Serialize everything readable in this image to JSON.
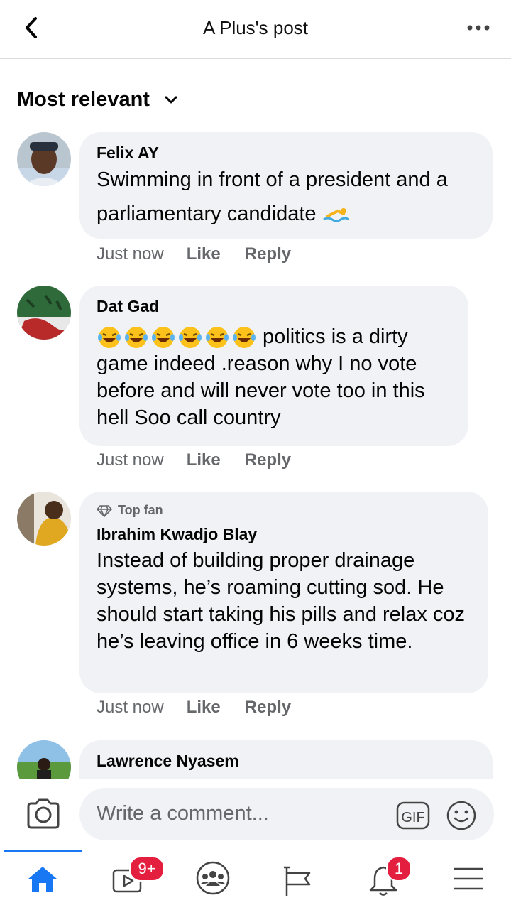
{
  "header": {
    "title": "A Plus's post"
  },
  "sort": {
    "label": "Most relevant"
  },
  "comments": [
    {
      "name": "Felix AY",
      "text": "Swimming in front of a president and a parliamentary candidate",
      "emoji": "swimmer-emoji",
      "time": "Just now",
      "like": "Like",
      "reply": "Reply"
    },
    {
      "name": "Dat Gad",
      "text_lines": [
        "politics is a dirty",
        "game indeed .reason why I no vote",
        "before and will never vote too in this",
        "hell Soo call country"
      ],
      "emoji": "laughing-tears-emoji",
      "time": "Just now",
      "like": "Like",
      "reply": "Reply"
    },
    {
      "badge": "Top fan",
      "name": "Ibrahim Kwadjo Blay",
      "text": "Instead of building proper drainage systems, he’s roaming cutting sod. He should start taking his pills and relax coz he’s leaving office in 6 weeks time.",
      "time": "Just now",
      "like": "Like",
      "reply": "Reply"
    },
    {
      "name": "Lawrence Nyasem"
    }
  ],
  "composer": {
    "placeholder": "Write a comment...",
    "gif_label": "GIF"
  },
  "tabs": {
    "items": [
      "home-icon",
      "video-icon",
      "groups-icon",
      "pages-icon",
      "notifications-icon",
      "menu-icon"
    ],
    "video_badge": "9+",
    "notifications_badge": "1"
  },
  "colors": {
    "accent": "#1877f2",
    "badge": "#e41e3f",
    "bubble": "#f0f2f5",
    "meta": "#65676b"
  }
}
